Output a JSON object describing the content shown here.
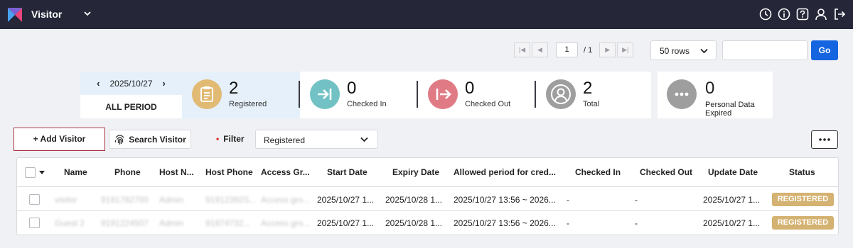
{
  "app": {
    "title": "Visitor"
  },
  "colors": {
    "topbar": "#252638",
    "accent": "#1565e0",
    "registered": "#e1ba73",
    "checked_in": "#72c2c5",
    "checked_out": "#e07b86",
    "total": "#9e9e9e",
    "badge": "#d4b271",
    "active_stat_bg": "#e5f0fb"
  },
  "header_icons": [
    "clock-icon",
    "info-icon",
    "help-icon",
    "user-icon",
    "logout-icon"
  ],
  "pagination": {
    "current_page": "1",
    "separator": "/ 1"
  },
  "toolbar": {
    "rows_per_page": "50 rows",
    "search_value": "",
    "go_label": "Go"
  },
  "date_filter": {
    "date": "2025/10/27",
    "all_period_label": "ALL PERIOD"
  },
  "stats": [
    {
      "count": "2",
      "label": "Registered"
    },
    {
      "count": "0",
      "label": "Checked In"
    },
    {
      "count": "0",
      "label": "Checked Out"
    },
    {
      "count": "2",
      "label": "Total"
    }
  ],
  "expired_stat": {
    "count": "0",
    "label_line1": "Personal Data",
    "label_line2": "Expired"
  },
  "actions": {
    "add_visitor": "+ Add Visitor",
    "search_visitor": "Search Visitor",
    "filter_label": "Filter",
    "filter_value": "Registered"
  },
  "table": {
    "headers": [
      "Name",
      "Phone",
      "Host N...",
      "Host Phone",
      "Access Gr...",
      "Start Date",
      "Expiry Date",
      "Allowed period for cred...",
      "Checked In",
      "Checked Out",
      "Update Date",
      "Status"
    ],
    "rows": [
      {
        "name": "visitor",
        "phone": "9191782700",
        "host_name": "Admin",
        "host_phone": "91912392S...",
        "access_group": "Access gro...",
        "start_date": "2025/10/27 1...",
        "expiry_date": "2025/10/28 1...",
        "allowed_period": "2025/10/27 13:56 ~ 2026...",
        "checked_in": "-",
        "checked_out": "-",
        "update_date": "2025/10/27 1...",
        "status": "REGISTERED"
      },
      {
        "name": "Guest 2",
        "phone": "9191224507",
        "host_name": "Admin",
        "host_phone": "91974732...",
        "access_group": "Access gro...",
        "start_date": "2025/10/27 1...",
        "expiry_date": "2025/10/28 1...",
        "allowed_period": "2025/10/27 13:56 ~ 2026...",
        "checked_in": "-",
        "checked_out": "-",
        "update_date": "2025/10/27 1...",
        "status": "REGISTERED"
      }
    ]
  }
}
